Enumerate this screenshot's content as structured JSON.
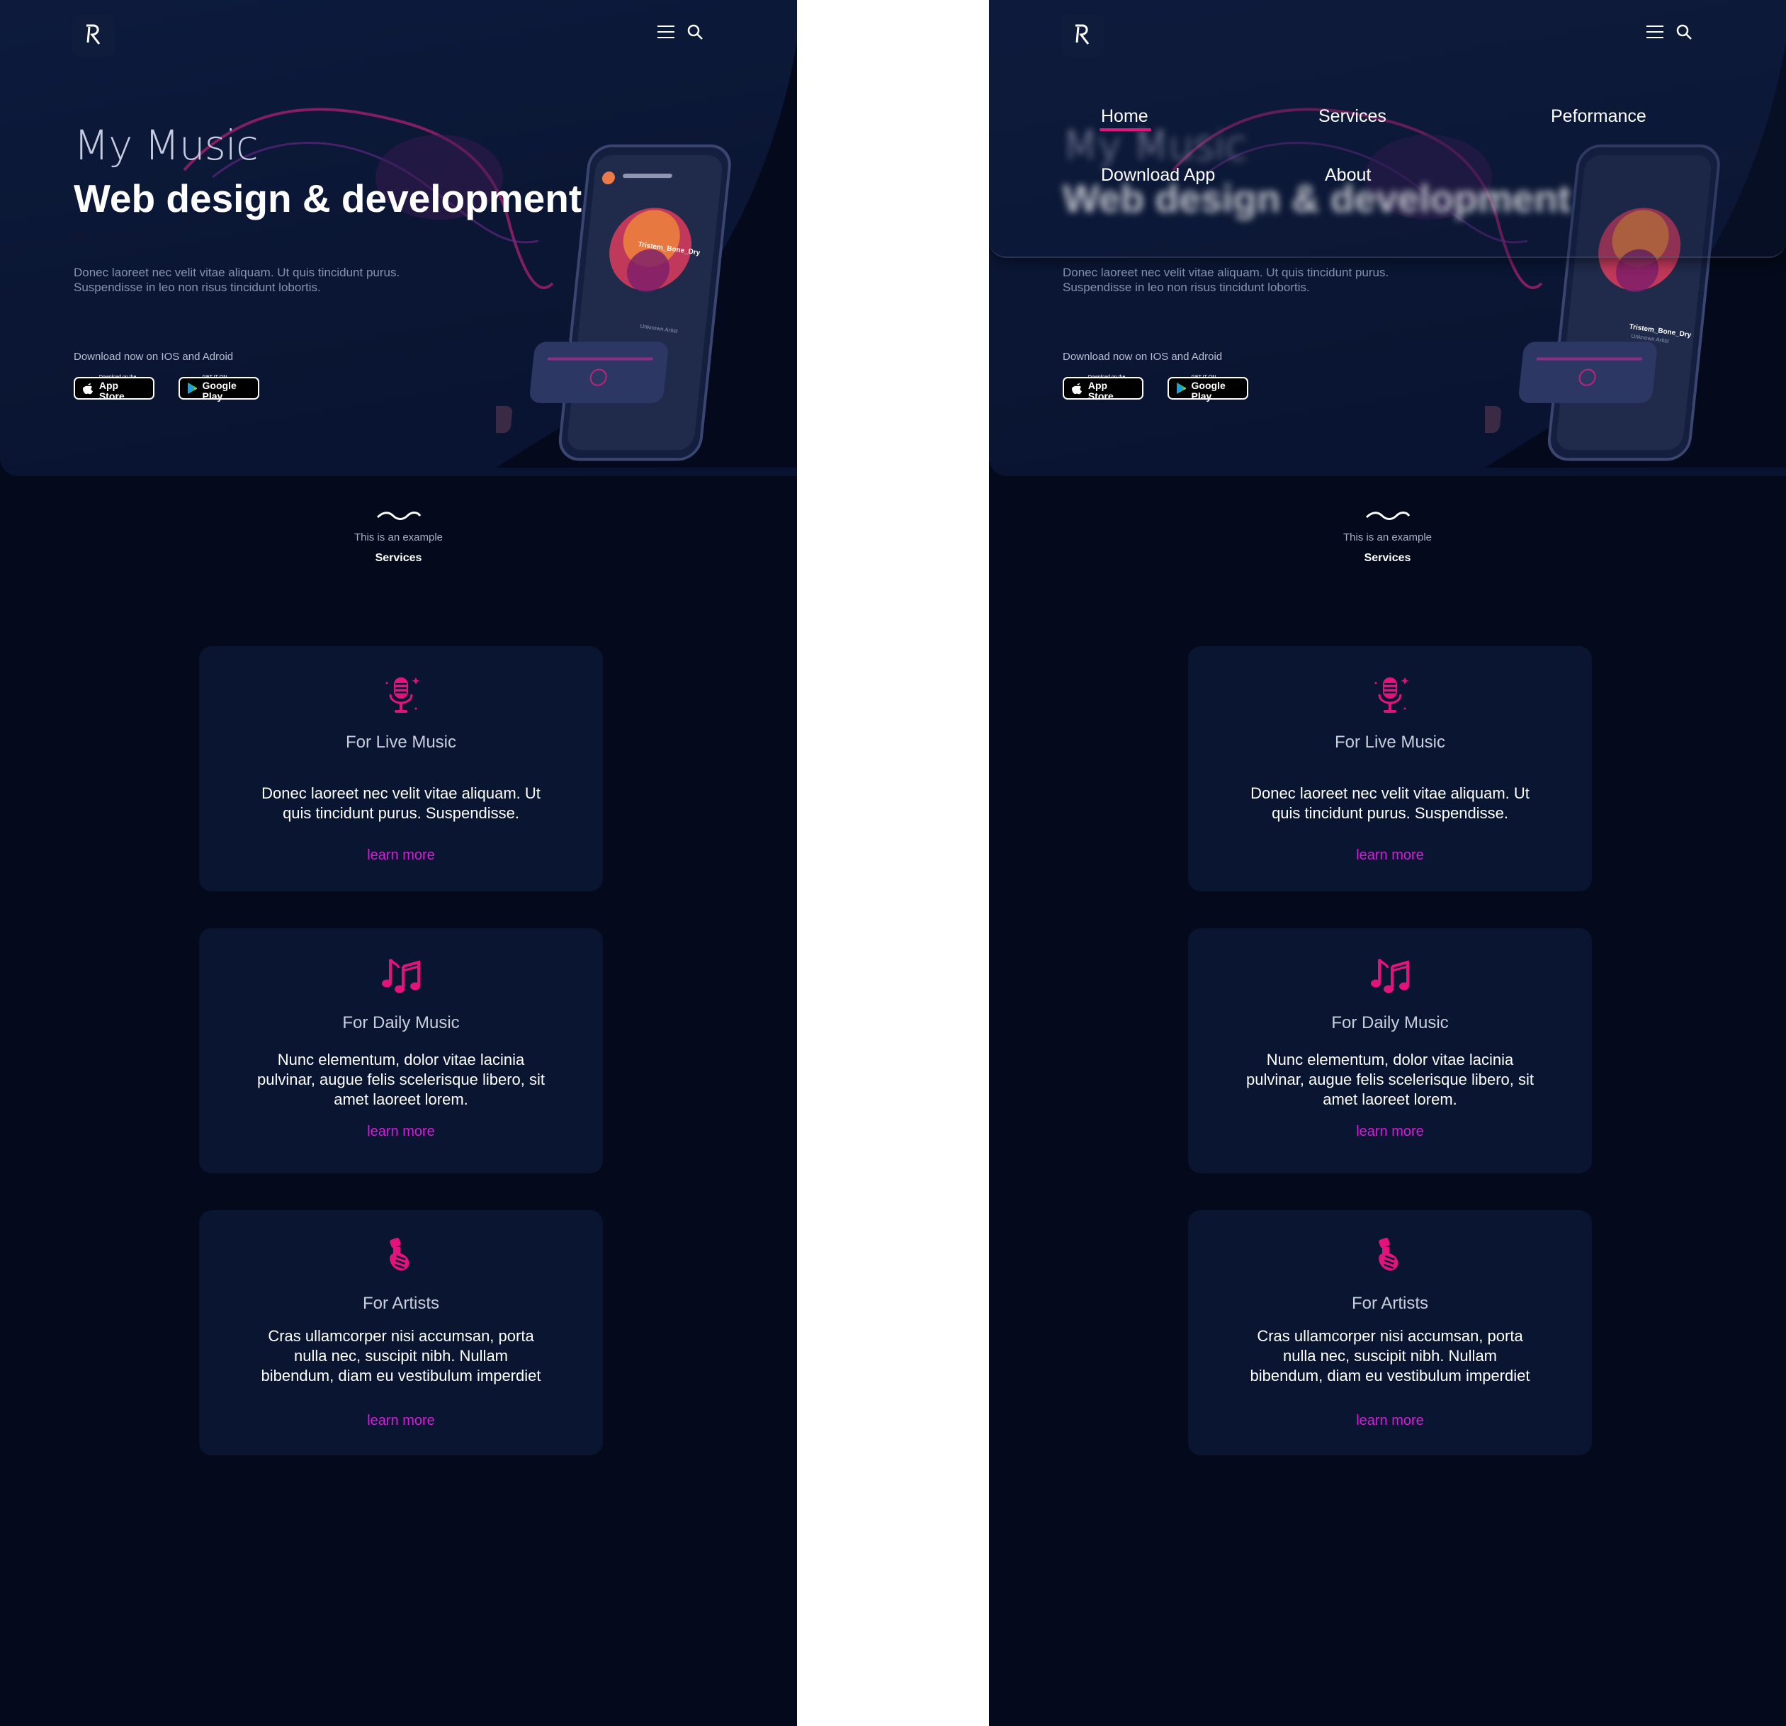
{
  "hero": {
    "title": "My Music",
    "subtitle": "Web design & development",
    "description_line1": "Donec laoreet nec velit vitae aliquam. Ut quis tincidunt purus.",
    "description_line2": "Suspendisse in leo non risus tincidunt lobortis.",
    "download_text": "Download now on IOS and Adroid"
  },
  "stores": {
    "apple_small": "Download on the",
    "apple_big": "App Store",
    "google_small": "GET IT ON",
    "google_big": "Google Play"
  },
  "phone": {
    "track_name": "Tristem_Bone_Dry",
    "artist": "Unknown Artist"
  },
  "section": {
    "subtitle": "This is an example",
    "title": "Services"
  },
  "cards": [
    {
      "title": "For Live Music",
      "text": "Donec laoreet nec velit vitae aliquam. Ut quis tincidunt purus. Suspendisse.",
      "link": "learn more",
      "icon": "microphone-icon"
    },
    {
      "title": "For Daily Music",
      "text": "Nunc elementum, dolor vitae lacinia pulvinar, augue felis scelerisque libero, sit amet laoreet lorem.",
      "link": "learn more",
      "icon": "music-notes-icon"
    },
    {
      "title": "For Artists",
      "text": "Cras ullamcorper nisi accumsan, porta nulla nec, suscipit nibh. Nullam bibendum, diam eu vestibulum imperdiet",
      "link": "learn more",
      "icon": "guitar-hand-icon"
    }
  ],
  "menu": {
    "items": [
      "Home",
      "Services",
      "Peformance",
      "Download App",
      "About"
    ],
    "active": "Home"
  },
  "colors": {
    "background": "#040a1b",
    "hero": "#0d1a3c",
    "card": "#0a1631",
    "accent_pink": "#e2157f",
    "link_magenta": "#d21fd6"
  }
}
